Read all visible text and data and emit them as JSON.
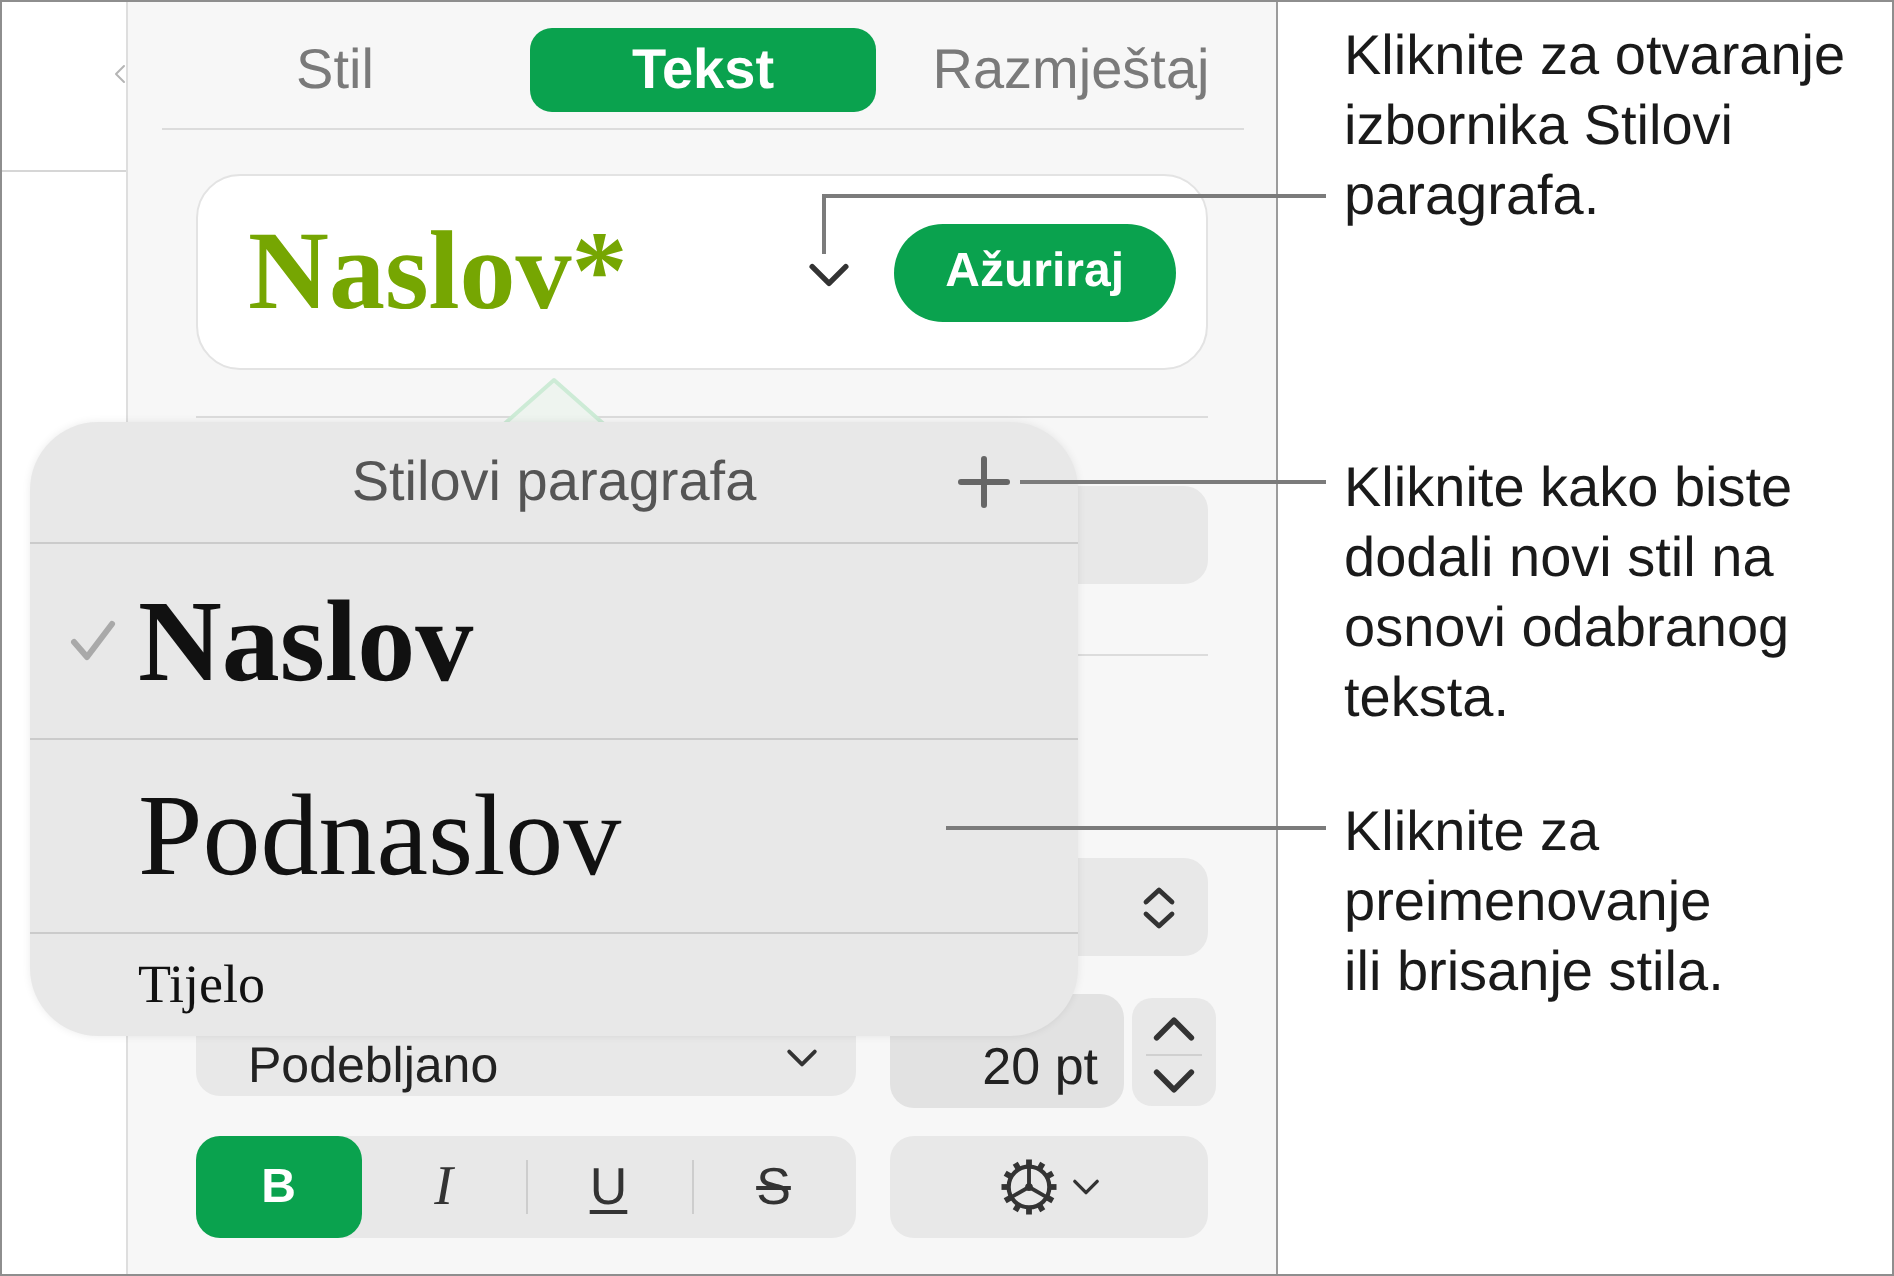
{
  "tabs": [
    {
      "label": "Stil",
      "selected": false
    },
    {
      "label": "Tekst",
      "selected": true
    },
    {
      "label": "Razmještaj",
      "selected": false
    }
  ],
  "paragraph_style": {
    "name": "Naslov*",
    "update_button": "Ažuriraj"
  },
  "styles_popover": {
    "title": "Stilovi paragrafa",
    "items": [
      {
        "label": "Naslov",
        "kind": "heading",
        "selected": true
      },
      {
        "label": "Podnaslov",
        "kind": "subheading",
        "selected": false
      },
      {
        "label": "Tijelo",
        "kind": "body",
        "selected": false
      }
    ]
  },
  "font": {
    "style": "Podebljano",
    "size": "20 pt"
  },
  "format_buttons": [
    {
      "label": "B",
      "kind": "bold",
      "on": true
    },
    {
      "label": "I",
      "kind": "italic",
      "on": false
    },
    {
      "label": "U",
      "kind": "underline",
      "on": false
    },
    {
      "label": "S",
      "kind": "strikethrough",
      "on": false
    }
  ],
  "callouts": [
    "Kliknite za otvaranje izbornika Stilovi paragrafa.",
    "Kliknite kako biste dodali novi stil na osnovi odabranog teksta.",
    "Kliknite za preimenovanje ili brisanje stila."
  ]
}
